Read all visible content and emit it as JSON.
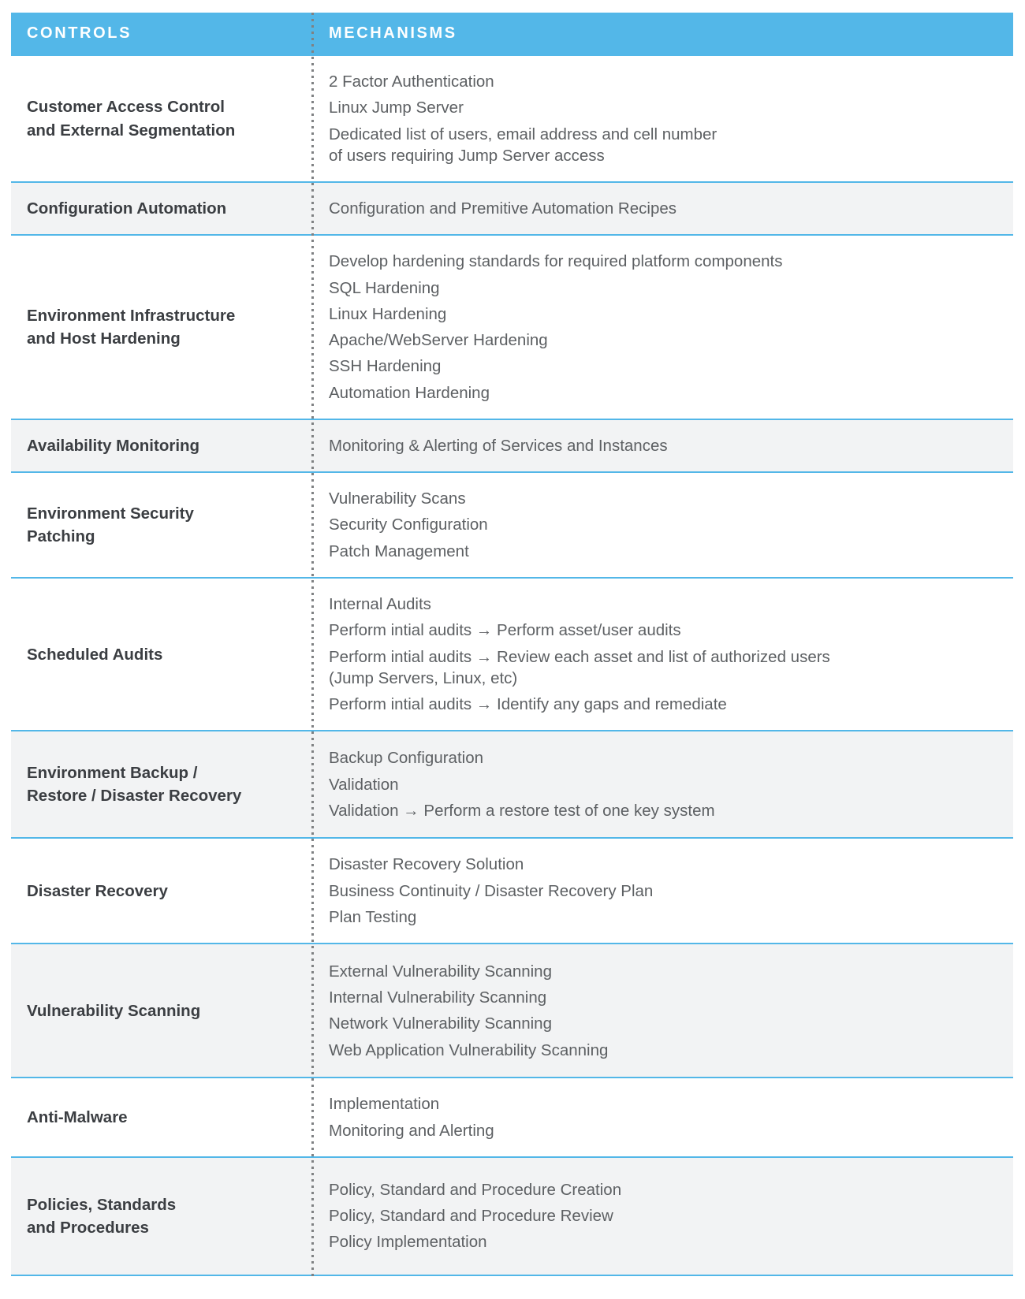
{
  "table": {
    "columns": {
      "controls_header": "CONTROLS",
      "mechanisms_header": "MECHANISMS"
    },
    "colors": {
      "header_bg": "#53b7e8",
      "row_rule": "#53b7e8",
      "shaded_row_bg": "#f2f3f4",
      "control_text": "#3b3e42",
      "mechanism_text": "#5d6063",
      "divider_dots": "#7f8183",
      "header_text": "#ffffff"
    },
    "rows": [
      {
        "control": "Customer Access Control\nand External Segmentation",
        "shaded": false,
        "mechanisms": [
          "2 Factor Authentication",
          "Linux Jump Server",
          "Dedicated list of users, email address and cell number\nof users requiring Jump Server access"
        ]
      },
      {
        "control": "Configuration Automation",
        "shaded": true,
        "mechanisms": [
          "Configuration and Premitive Automation Recipes"
        ]
      },
      {
        "control": "Environment Infrastructure\nand Host Hardening",
        "shaded": false,
        "mechanisms": [
          "Develop hardening standards for required platform components",
          "SQL Hardening",
          "Linux Hardening",
          "Apache/WebServer Hardening",
          "SSH Hardening",
          "Automation Hardening"
        ]
      },
      {
        "control": "Availability Monitoring",
        "shaded": true,
        "mechanisms": [
          "Monitoring & Alerting of Services and Instances"
        ]
      },
      {
        "control": "Environment Security\nPatching",
        "shaded": false,
        "mechanisms": [
          "Vulnerability Scans",
          "Security Configuration",
          "Patch Management"
        ]
      },
      {
        "control": "Scheduled Audits",
        "shaded": false,
        "mechanisms": [
          "Internal Audits",
          "Perform intial audits → Perform asset/user audits",
          "Perform intial audits → Review each asset and list of authorized users\n(Jump Servers, Linux, etc)",
          "Perform intial audits → Identify any gaps and remediate"
        ]
      },
      {
        "control": "Environment Backup /\nRestore / Disaster Recovery",
        "shaded": true,
        "mechanisms": [
          "Backup Configuration",
          "Validation",
          "Validation → Perform a restore test of one key system"
        ]
      },
      {
        "control": "Disaster Recovery",
        "shaded": false,
        "mechanisms": [
          "Disaster Recovery Solution",
          "Business Continuity / Disaster Recovery Plan",
          "Plan Testing"
        ]
      },
      {
        "control": "Vulnerability Scanning",
        "shaded": true,
        "mechanisms": [
          "External Vulnerability Scanning",
          "Internal Vulnerability Scanning",
          "Network Vulnerability Scanning",
          "Web Application Vulnerability Scanning"
        ]
      },
      {
        "control": "Anti-Malware",
        "shaded": false,
        "mechanisms": [
          "Implementation",
          "Monitoring and Alerting"
        ]
      },
      {
        "control": "Policies, Standards\nand Procedures",
        "shaded": true,
        "mechanisms": [
          "Policy, Standard and Procedure Creation",
          "Policy, Standard and Procedure Review",
          "Policy Implementation"
        ]
      }
    ]
  }
}
